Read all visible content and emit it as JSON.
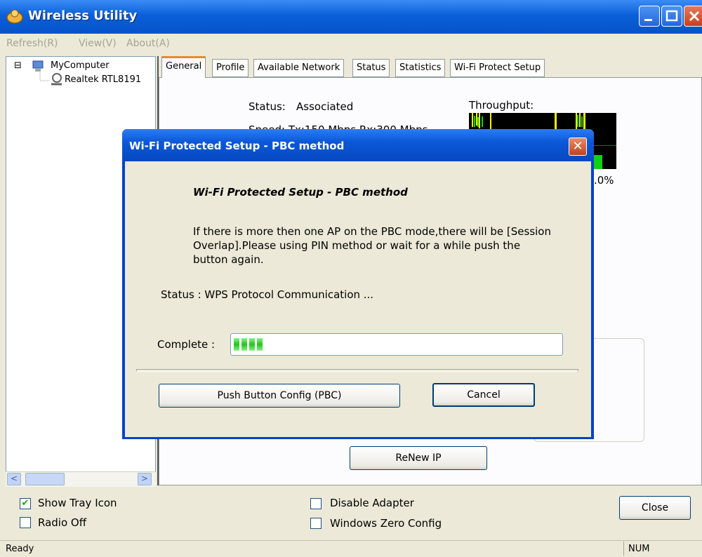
{
  "window": {
    "title": "Wireless Utility",
    "controls": {
      "minimize": "_",
      "maximize": "□",
      "close": "X"
    }
  },
  "menu": [
    "Refresh(R)",
    "View(V)",
    "About(A)"
  ],
  "tree": {
    "root": "MyComputer",
    "child": "Realtek RTL8191",
    "expander": "⊟"
  },
  "tabs": [
    "General",
    "Profile",
    "Available Network",
    "Status",
    "Statistics",
    "Wi-Fi Protect Setup"
  ],
  "general": {
    "status_label": "Status:",
    "status_value": "Associated",
    "speed_partial": "Speed:   Tx:150 Mbps Rx:300 Mbps",
    "throughput_label": "Throughput:",
    "percent_partial": ".0%",
    "renew_ip_label": "ReNew IP"
  },
  "dialog": {
    "title": "Wi-Fi Protected Setup - PBC method",
    "close_glyph": "✕",
    "heading": "Wi-Fi Protected Setup - PBC method",
    "message": "If there is more then one AP on the PBC mode,there will be [Session Overlap].Please using PIN method or wait for a while push the button again.",
    "status": "Status : WPS Protocol Communication ...",
    "complete_label": "Complete :",
    "progress_fraction": 0.13,
    "pbc_button": "Push Button Config (PBC)",
    "cancel_button": "Cancel"
  },
  "bottom": {
    "show_tray_icon": {
      "label": "Show Tray Icon",
      "checked": true
    },
    "radio_off": {
      "label": "Radio Off",
      "checked": false
    },
    "disable_adapter": {
      "label": "Disable Adapter",
      "checked": false
    },
    "windows_zero_config": {
      "label": "Windows Zero Config",
      "checked": false
    },
    "close_button": "Close"
  },
  "statusbar": {
    "left": "Ready",
    "num": "NUM"
  },
  "colors": {
    "title_blue": "#0a5fd8",
    "progress_green": "#22c21f",
    "tab_highlight": "#e68b2c"
  }
}
